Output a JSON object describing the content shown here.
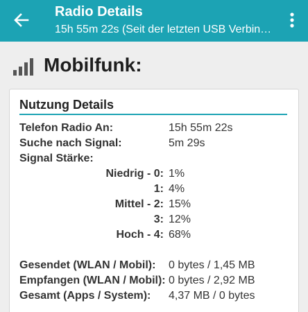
{
  "appbar": {
    "title": "Radio Details",
    "subtitle": "15h 55m 22s (Seit der letzten USB Verbindung)"
  },
  "section": {
    "title": "Mobilfunk:",
    "icon": "signal-bars-icon"
  },
  "card": {
    "title": "Nutzung Details",
    "rows": {
      "radio_on": {
        "label": "Telefon Radio An:",
        "value": "15h 55m 22s"
      },
      "searching": {
        "label": "Suche nach Signal:",
        "value": "5m 29s"
      },
      "strength": {
        "label": "Signal Stärke:"
      },
      "level0": {
        "label": "Niedrig - 0:",
        "value": "1%"
      },
      "level1": {
        "label": "1:",
        "value": "4%"
      },
      "level2": {
        "label": "Mittel - 2:",
        "value": "15%"
      },
      "level3": {
        "label": "3:",
        "value": "12%"
      },
      "level4": {
        "label": "Hoch - 4:",
        "value": "68%"
      },
      "sent": {
        "label": "Gesendet (WLAN / Mobil):",
        "value": "0 bytes / 1,45 MB"
      },
      "received": {
        "label": "Empfangen (WLAN / Mobil):",
        "value": "0 bytes / 2,92 MB"
      },
      "total": {
        "label": "Gesamt (Apps / System):",
        "value": "4,37 MB / 0 bytes"
      }
    }
  },
  "colors": {
    "appbar": "#1ca3b4",
    "accent_rule": "#1ca3b4",
    "background": "#eeeeee"
  }
}
